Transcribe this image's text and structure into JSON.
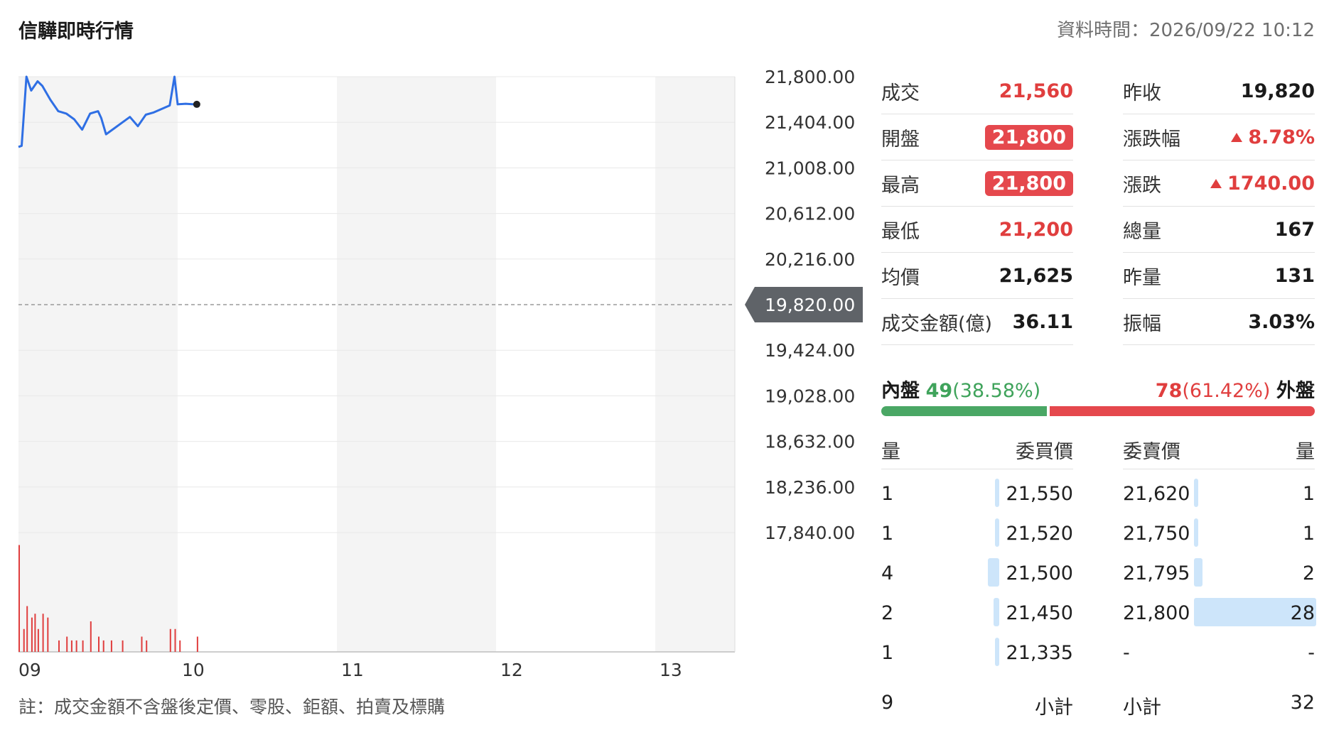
{
  "header": {
    "title": "信驊即時行情",
    "updated": "資料時間：2026/09/22 10:12"
  },
  "footnote": "註：成交金額不含盤後定價、零股、鉅額、拍賣及標購",
  "quote": {
    "left": [
      {
        "label": "成交",
        "value": "21,560",
        "style": "red"
      },
      {
        "label": "開盤",
        "value": "21,800",
        "style": "badge"
      },
      {
        "label": "最高",
        "value": "21,800",
        "style": "badge"
      },
      {
        "label": "最低",
        "value": "21,200",
        "style": "red"
      },
      {
        "label": "均價",
        "value": "21,625",
        "style": "normal"
      },
      {
        "label": "成交金額(億)",
        "value": "36.11",
        "style": "normal"
      }
    ],
    "right": [
      {
        "label": "昨收",
        "value": "19,820",
        "style": "normal"
      },
      {
        "label": "漲跌幅",
        "value": "8.78%",
        "style": "up"
      },
      {
        "label": "漲跌",
        "value": "1740.00",
        "style": "up"
      },
      {
        "label": "總量",
        "value": "167",
        "style": "normal"
      },
      {
        "label": "昨量",
        "value": "131",
        "style": "normal"
      },
      {
        "label": "振幅",
        "value": "3.03%",
        "style": "normal"
      }
    ],
    "colors": {
      "up": "#e03e3e",
      "down": "#3fa35b",
      "badge": "#e5484d"
    }
  },
  "inner_outer": {
    "inner_label": "內盤",
    "inner_count": "49",
    "inner_pct": "(38.58%)",
    "outer_label": "外盤",
    "outer_count": "78",
    "outer_pct": "(61.42%)",
    "inner_fraction": 0.3858
  },
  "order_book": {
    "buy_headers": {
      "qty": "量",
      "price": "委買價"
    },
    "sell_headers": {
      "price": "委賣價",
      "qty": "量"
    },
    "buy": [
      {
        "qty": "1",
        "price": "21,550",
        "level": 1
      },
      {
        "qty": "1",
        "price": "21,520",
        "level": 1
      },
      {
        "qty": "4",
        "price": "21,500",
        "level": 4
      },
      {
        "qty": "2",
        "price": "21,450",
        "level": 2
      },
      {
        "qty": "1",
        "price": "21,335",
        "level": 1
      }
    ],
    "sell": [
      {
        "price": "21,620",
        "qty": "1",
        "level": 1
      },
      {
        "price": "21,750",
        "qty": "1",
        "level": 1
      },
      {
        "price": "21,795",
        "qty": "2",
        "level": 2
      },
      {
        "price": "21,800",
        "qty": "28",
        "level": 28
      },
      {
        "price": "-",
        "qty": "-",
        "level": 0
      }
    ],
    "max_level": 28,
    "buy_total": {
      "qty": "9",
      "label": "小計"
    },
    "sell_total": {
      "label": "小計",
      "qty": "32"
    }
  },
  "chart_data": {
    "type": "line",
    "x_ticks": [
      "09",
      "10",
      "11",
      "12",
      "13"
    ],
    "x_range": [
      9,
      13.5
    ],
    "y_ticks": [
      "21,800.00",
      "21,404.00",
      "21,008.00",
      "20,612.00",
      "20,216.00",
      "19,820.00",
      "19,424.00",
      "19,028.00",
      "18,632.00",
      "18,236.00",
      "17,840.00"
    ],
    "ylim": [
      17840,
      21800
    ],
    "reference": {
      "value": 19820,
      "label": "19,820.00"
    },
    "price": {
      "x": [
        9.0,
        9.02,
        9.05,
        9.08,
        9.12,
        9.15,
        9.2,
        9.25,
        9.3,
        9.35,
        9.4,
        9.45,
        9.5,
        9.52,
        9.55,
        9.6,
        9.65,
        9.7,
        9.75,
        9.8,
        9.85,
        9.95,
        9.98,
        10.0,
        10.05,
        10.1,
        10.12
      ],
      "y": [
        21190,
        21200,
        21800,
        21680,
        21760,
        21720,
        21600,
        21500,
        21480,
        21430,
        21340,
        21480,
        21500,
        21440,
        21300,
        21350,
        21400,
        21450,
        21370,
        21470,
        21490,
        21550,
        21800,
        21560,
        21565,
        21560,
        21560
      ]
    },
    "volume": {
      "x": [
        9.0,
        9.03,
        9.05,
        9.08,
        9.1,
        9.12,
        9.15,
        9.18,
        9.25,
        9.3,
        9.33,
        9.36,
        9.4,
        9.45,
        9.5,
        9.53,
        9.58,
        9.65,
        9.77,
        9.8,
        9.95,
        9.98,
        10.01,
        10.12
      ],
      "y": [
        28,
        6,
        12,
        9,
        10,
        6,
        10,
        9,
        3,
        4,
        3,
        3,
        3,
        8,
        4,
        3,
        3,
        3,
        4,
        3,
        6,
        6,
        3,
        4
      ]
    }
  }
}
